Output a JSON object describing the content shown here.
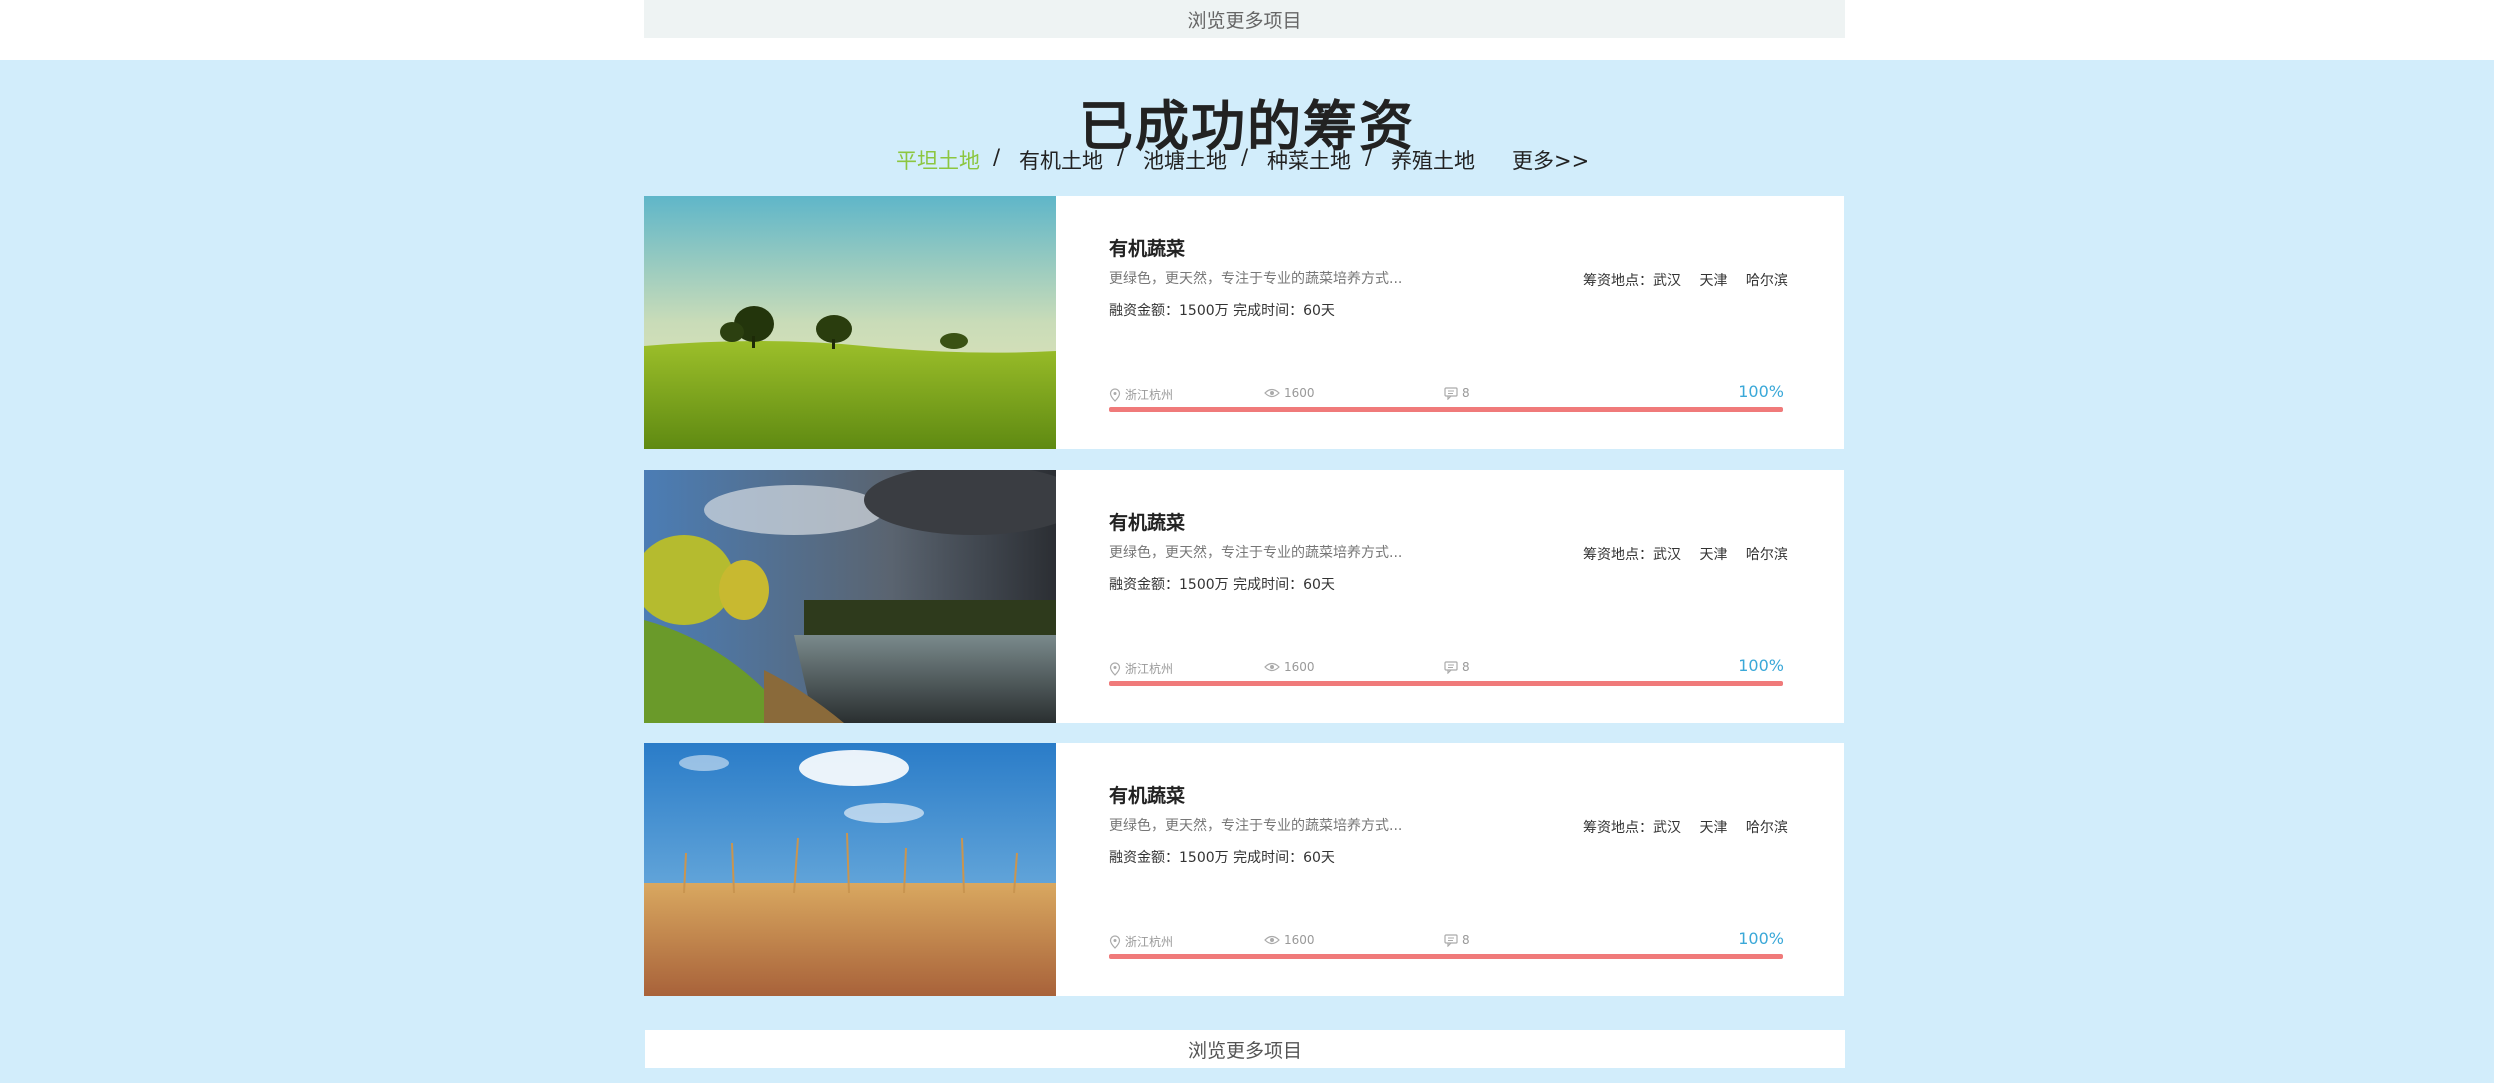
{
  "top_browse_label": "浏览更多项目",
  "section_title": "已成功的筹资",
  "categories": {
    "items": [
      "平坦土地",
      "有机土地",
      "池塘土地",
      "种菜土地",
      "养殖土地"
    ],
    "separator": "/",
    "more": "更多>>",
    "active_color": "#8cc63f"
  },
  "cards": [
    {
      "image": "golf-field-sunset",
      "title": "有机蔬菜",
      "desc": "更绿色，更天然，专注于专业的蔬菜培养方式...",
      "amount": "融资金额：1500万  完成时间：60天",
      "location_label": "筹资地点：武汉",
      "locations": [
        "天津",
        "哈尔滨"
      ],
      "city": "浙江杭州",
      "views": "1600",
      "comments": "8",
      "progress_percent": 100,
      "progress_label": "100%"
    },
    {
      "image": "lake-storm-clouds",
      "title": "有机蔬菜",
      "desc": "更绿色，更天然，专注于专业的蔬菜培养方式...",
      "amount": "融资金额：1500万  完成时间：60天",
      "location_label": "筹资地点：武汉",
      "locations": [
        "天津",
        "哈尔滨"
      ],
      "city": "浙江杭州",
      "views": "1600",
      "comments": "8",
      "progress_percent": 100,
      "progress_label": "100%"
    },
    {
      "image": "wheat-field-blue-sky",
      "title": "有机蔬菜",
      "desc": "更绿色，更天然，专注于专业的蔬菜培养方式...",
      "amount": "融资金额：1500万  完成时间：60天",
      "location_label": "筹资地点：武汉",
      "locations": [
        "天津",
        "哈尔滨"
      ],
      "city": "浙江杭州",
      "views": "1600",
      "comments": "8",
      "progress_percent": 100,
      "progress_label": "100%"
    }
  ],
  "bottom_browse_label": "浏览更多项目",
  "colors": {
    "section_bg": "#d2edfb",
    "progress_bar": "#f07a7a",
    "percent_text": "#3aa8d8"
  }
}
